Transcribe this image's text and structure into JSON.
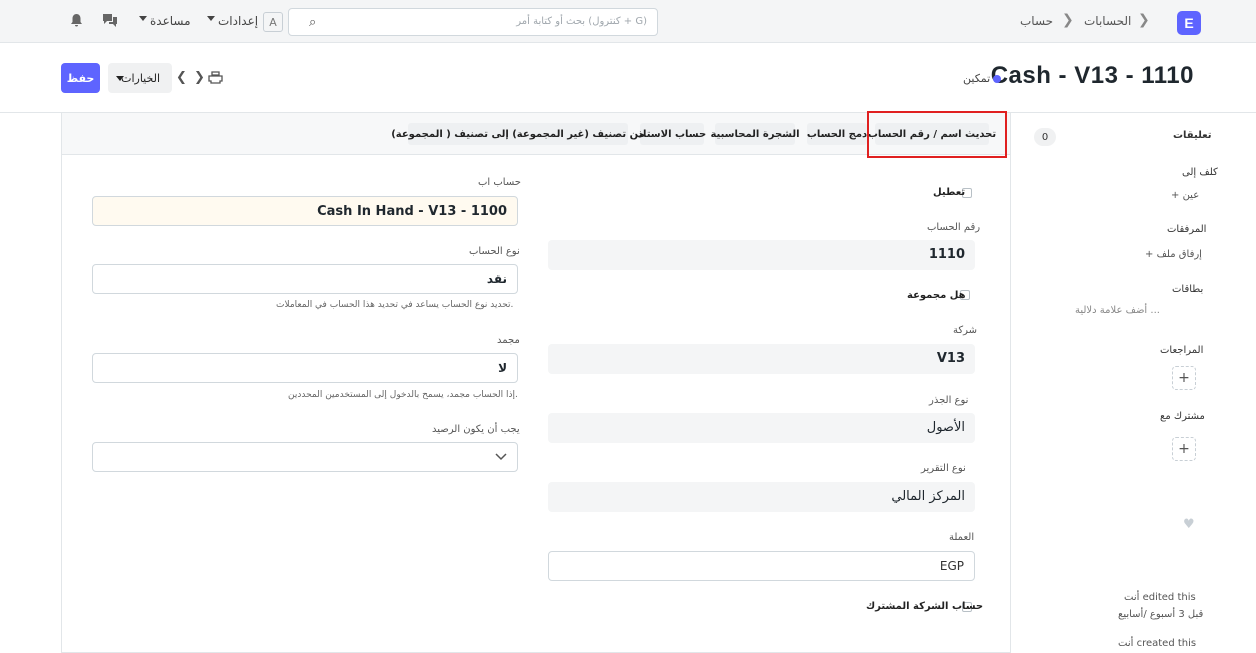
{
  "navbar": {
    "logo": "E",
    "breadcrumbs": [
      "الحسابات",
      "حساب"
    ],
    "search_placeholder": "بحث أو كتابة أمر (كنترول + G)",
    "settings_label": "إعدادات",
    "settings_badge": "A",
    "help_label": "مساعدة"
  },
  "page": {
    "title": "Cash - V13 - 1110",
    "status": "تمكين",
    "save_label": "حفظ",
    "actions_label": "الخيارات"
  },
  "toolbar": {
    "buttons": [
      "تحديث اسم / رقم الحساب",
      "دمج الحساب",
      "الشجرة المحاسبية",
      "حساب الاستاذ",
      "من تصنيف (غير المجموعة) إلى تصنيف ( المجموعة)"
    ]
  },
  "sidebar": {
    "comments_label": "تعليقات",
    "comments_count": "0",
    "assign_label": "كلف إلى",
    "assign_action": "+ عين",
    "attachments_label": "المرفقات",
    "attach_action": "+ إرفاق ملف",
    "tags_label": "بطاقات",
    "tags_action": "أضف علامة دلالية ...",
    "reviews_label": "المراجعات",
    "shared_label": "مشترك مع",
    "activity_1": "أنت edited this",
    "activity_1_time": "قبل 3 أسبوع /أسابيع",
    "activity_2": "أنت created this"
  },
  "form": {
    "disabled_label": "تعطيل",
    "account_number_label": "رقم الحساب",
    "account_number": "1110",
    "is_group_label": "هل مجموعة",
    "company_label": "شركة",
    "company": "V13",
    "root_type_label": "نوع الجذر",
    "root_type": "الأصول",
    "report_type_label": "نوع التقرير",
    "report_type": "المركز المالي",
    "currency_label": "العملة",
    "currency": "EGP",
    "common_company_label": "حساب الشركة المشترك",
    "parent_account_label": "حساب اب",
    "parent_account": "Cash In Hand - V13 - 1100",
    "account_type_label": "نوع الحساب",
    "account_type": "نقد",
    "account_type_desc": "تحديد نوع الحساب يساعد في تحديد هذا الحساب في المعاملات.",
    "frozen_label": "مجمد",
    "frozen": "لا",
    "frozen_desc": "إذا الحساب مجمد، يسمح بالدخول إلى المستخدمين المحددين.",
    "balance_must_be_label": "يجب أن يكون الرصيد",
    "balance_must_be": ""
  },
  "colors": {
    "primary": "#5e64ff",
    "highlight": "#e02020"
  },
  "icons": [
    "search-icon",
    "bell-icon",
    "chat-icon",
    "print-icon",
    "chevron-left-icon",
    "chevron-right-icon",
    "heart-icon",
    "plus-icon",
    "chevron-down-icon"
  ]
}
